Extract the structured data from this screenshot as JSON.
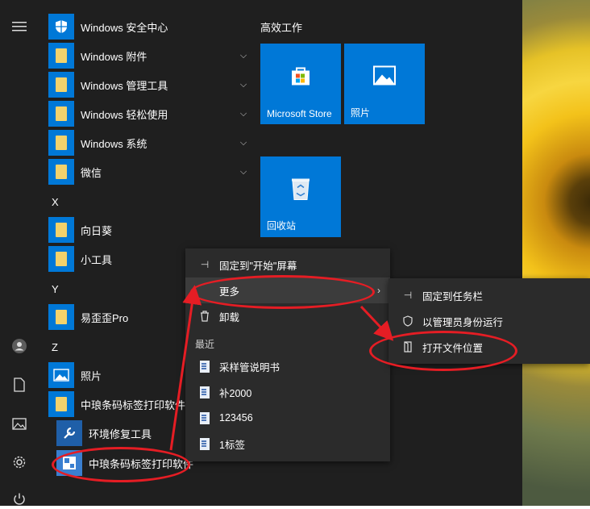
{
  "apps": {
    "security": "Windows 安全中心",
    "accessories": "Windows 附件",
    "admin_tools": "Windows 管理工具",
    "ease_access": "Windows 轻松使用",
    "system": "Windows 系统",
    "wechat": "微信",
    "letter_x": "X",
    "xiangrikui": "向日葵",
    "xiaogongju": "小工具",
    "letter_y": "Y",
    "yiwaiwai": "易歪歪Pro",
    "letter_z": "Z",
    "photos": "照片",
    "zhonglang_folder": "中琅条码标签打印软件",
    "repair_tool": "环境修复工具",
    "zhonglang_app": "中琅条码标签打印软件"
  },
  "tiles": {
    "group_title": "高效工作",
    "store": "Microsoft Store",
    "photos": "照片",
    "recycle": "回收站"
  },
  "context_menu": {
    "pin_start": "固定到\"开始\"屏幕",
    "more": "更多",
    "uninstall": "卸载",
    "recent_title": "最近",
    "recent": [
      "采样管说明书",
      "补2000",
      "123456",
      "1标签"
    ]
  },
  "submenu": {
    "pin_taskbar": "固定到任务栏",
    "run_admin": "以管理员身份运行",
    "open_location": "打开文件位置"
  },
  "colors": {
    "accent": "#0078d7",
    "annotation": "#e51d24",
    "menu_bg": "#2b2b2b",
    "start_bg": "#1f1f1f"
  }
}
